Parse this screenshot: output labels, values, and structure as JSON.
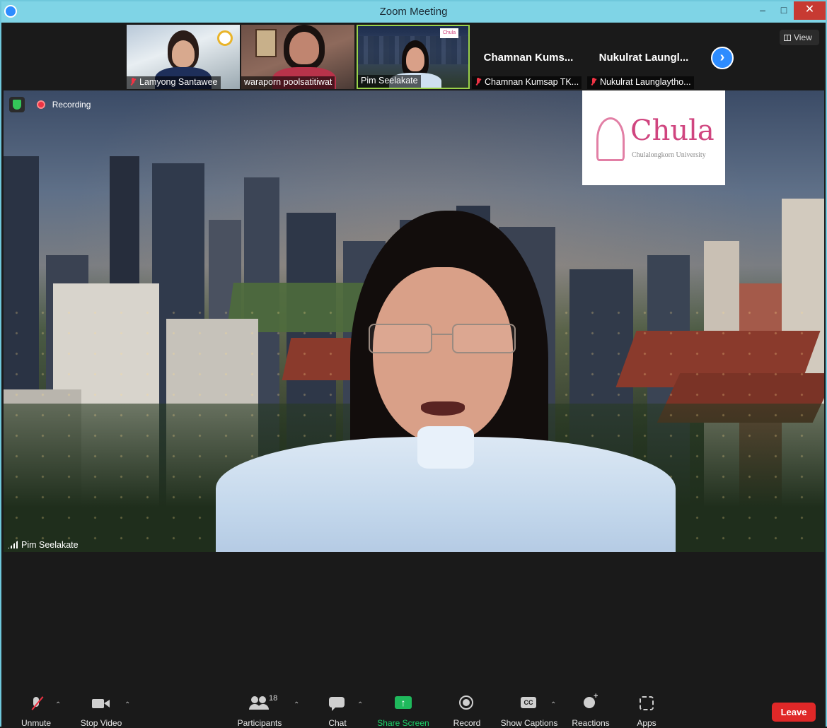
{
  "window": {
    "title": "Zoom Meeting",
    "minimize": "–",
    "maximize": "□",
    "close": "✕"
  },
  "gallery": {
    "participants": [
      {
        "name": "Lamyong Santawee",
        "muted": true,
        "video": true
      },
      {
        "name": "waraporn poolsatitiwat",
        "muted": false,
        "video": true
      },
      {
        "name": "Pim Seelakate",
        "muted": false,
        "video": true,
        "active_speaker": true
      },
      {
        "name": "Chamnan Kumsap TK...",
        "display_name": "Chamnan  Kums...",
        "muted": true,
        "video": false
      },
      {
        "name": "Nukulrat Launglaytho...",
        "display_name": "Nukulrat  Laungl...",
        "muted": true,
        "video": false
      }
    ],
    "next_page_icon": "chevron-right-icon",
    "view_label": "View"
  },
  "main_video": {
    "recording_label": "Recording",
    "speaker_name": "Pim Seelakate",
    "logo_text": "Chula",
    "logo_subtext": "Chulalongkorn University"
  },
  "toolbar": {
    "unmute": "Unmute",
    "stop_video": "Stop Video",
    "participants": "Participants",
    "participant_count": "18",
    "chat": "Chat",
    "share_screen": "Share Screen",
    "record": "Record",
    "show_captions": "Show Captions",
    "reactions": "Reactions",
    "apps": "Apps",
    "leave": "Leave"
  },
  "colors": {
    "title_bar": "#7fd4e6",
    "share_green": "#1fb95c",
    "leave_red": "#e02828",
    "active_speaker_border": "#9bd24a",
    "accent_blue": "#2d8cff"
  }
}
